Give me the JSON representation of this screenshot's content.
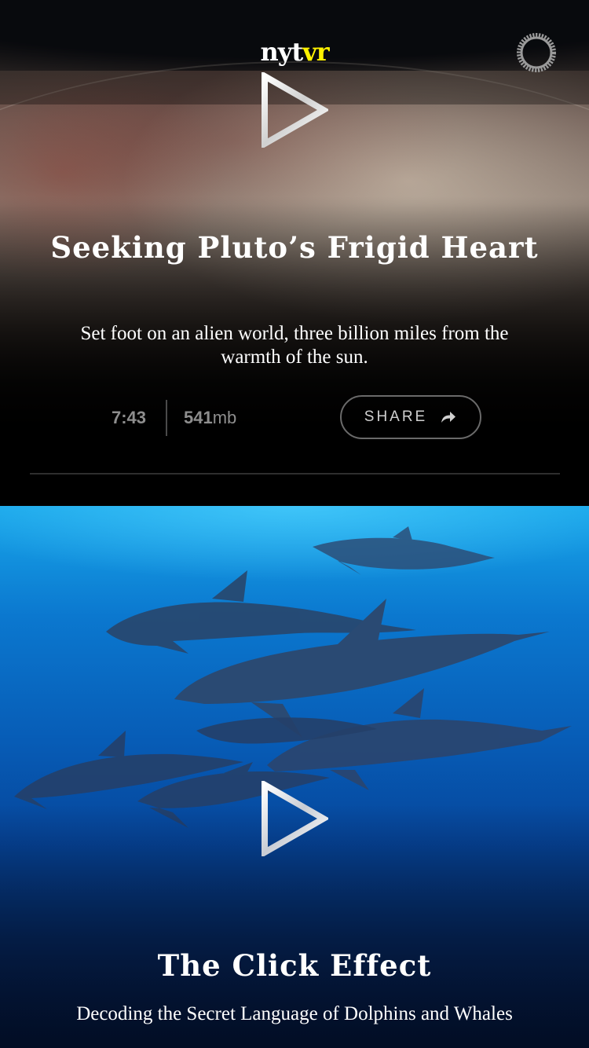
{
  "app": {
    "logo_prefix": "nyt",
    "logo_suffix": "vr",
    "accent_color": "#fff200",
    "settings_icon": "gear-icon"
  },
  "videos": [
    {
      "title": "Seeking Pluto’s Frigid Heart",
      "description": "Set foot on an alien world, three billion miles from the warmth of the sun.",
      "duration": "7:43",
      "size_value": "541",
      "size_unit": "mb",
      "share_label": "SHARE",
      "play_icon": "play-icon",
      "share_icon": "share-arrow-icon"
    },
    {
      "title": "The Click Effect",
      "description": "Decoding the Secret Language of Dolphins and Whales",
      "play_icon": "play-icon"
    }
  ]
}
